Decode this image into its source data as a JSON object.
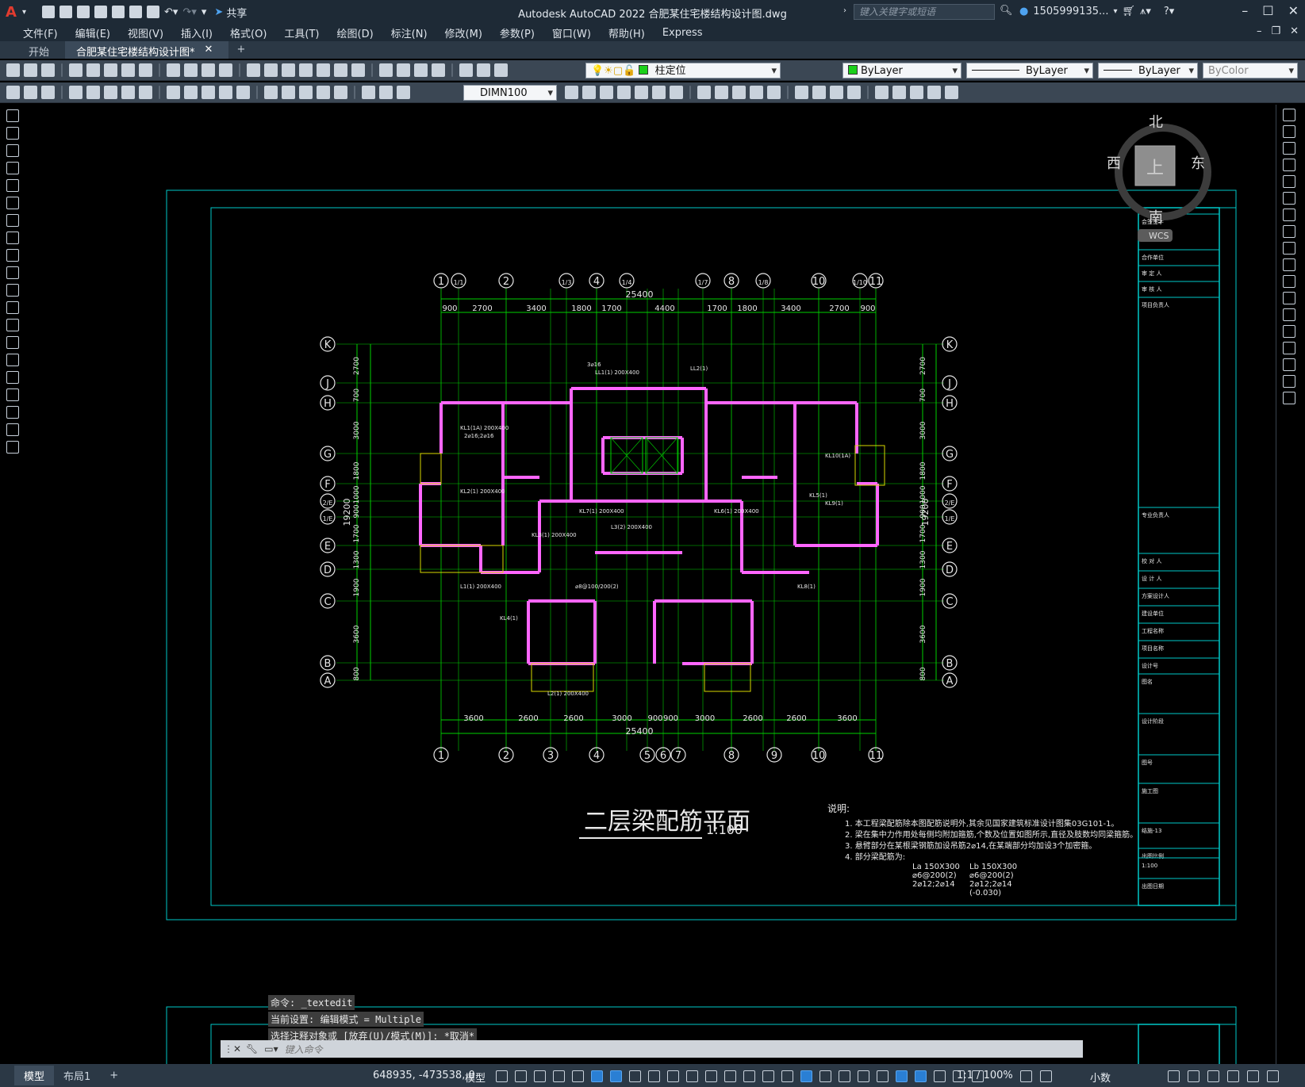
{
  "app": {
    "logo": "A",
    "title": "Autodesk AutoCAD 2022    合肥某住宅楼结构设计图.dwg",
    "share_label": "共享",
    "search_placeholder": "键入关键字或短语",
    "user": "1505999135...",
    "accent": "#e13b2f"
  },
  "menu": [
    "文件(F)",
    "编辑(E)",
    "视图(V)",
    "插入(I)",
    "格式(O)",
    "工具(T)",
    "绘图(D)",
    "标注(N)",
    "修改(M)",
    "参数(P)",
    "窗口(W)",
    "帮助(H)",
    "Express"
  ],
  "tabs": {
    "start": "开始",
    "doc": "合肥某住宅楼结构设计图*",
    "close": "✕",
    "add": "+"
  },
  "toolbar": {
    "layer": "柱定位",
    "color": "ByLayer",
    "linetype": "ByLayer",
    "lineweight": "ByLayer",
    "plotstyle": "ByColor",
    "dimstyle": "DIMN100"
  },
  "viewcube": {
    "north": "北",
    "south": "南",
    "east": "东",
    "west": "西",
    "top": "上",
    "wcs": "WCS"
  },
  "drawing": {
    "title": "二层梁配筋平面",
    "scale": "1:100",
    "top_total": "25400",
    "bottom_total": "25400",
    "left_total": "19200",
    "right_total": "19200",
    "top_dims": [
      "900",
      "2700",
      "3400",
      "1800",
      "1700",
      "4400",
      "1700",
      "1800",
      "3400",
      "2700",
      "900"
    ],
    "bottom_dims": [
      "3600",
      "2600",
      "2600",
      "3000",
      "900",
      "900",
      "3000",
      "2600",
      "2600",
      "3600"
    ],
    "left_dims": [
      "2700",
      "700",
      "3000",
      "1800",
      "1000",
      "900",
      "1700",
      "1300",
      "1900",
      "3600",
      "800"
    ],
    "top_axes": [
      "1",
      "1/1",
      "2",
      "1/3",
      "4",
      "1/4",
      "1/7",
      "8",
      "1/8",
      "10",
      "1/10",
      "11"
    ],
    "bottom_axes": [
      "1",
      "2",
      "3",
      "4",
      "5",
      "6",
      "7",
      "8",
      "9",
      "10",
      "11"
    ],
    "left_axes": [
      "K",
      "J",
      "H",
      "G",
      "F",
      "2/E",
      "1/E",
      "E",
      "D",
      "C",
      "B",
      "A"
    ],
    "notes_title": "说明:",
    "notes": [
      "1. 本工程梁配筋除本图配筋说明外,其余见国家建筑标准设计图集03G101-1。",
      "2. 梁在集中力作用处每侧均附加箍筋,个数及位置如图所示,直径及肢数均同梁箍筋。",
      "3. 悬臂部分在某根梁钢筋加设吊筋2⌀14,在某端部分均加设3个加密箍。",
      "4. 部分梁配筋为:"
    ],
    "beam_la": [
      "La 150X300",
      "⌀6@200(2)",
      "2⌀12;2⌀14"
    ],
    "beam_lb": [
      "Lb 150X300",
      "⌀6@200(2)",
      "2⌀12;2⌀14",
      "(-0.030)"
    ],
    "beam_labels": [
      "KL1(1A) 200X400",
      "KL2(1) 200X400",
      "KL3(1) 200X400",
      "KL4(1)",
      "KL5(1)",
      "KL6(1) 200X400",
      "KL7(1) 200X400",
      "KL8(1)",
      "KL9(1)",
      "KL10(1A)",
      "L1(1) 200X400",
      "L2(1) 200X400",
      "LL1(1) 200X400",
      "LL2(1)",
      "L3(2) 200X400",
      "3⌀16",
      "2⌀16;2⌀16",
      "⌀8@100/200(2)"
    ],
    "title_block": [
      "会签签字",
      "合作单位",
      "审 定 人",
      "审 核 人",
      "项目负责人",
      "专业负责人",
      "校 对 人",
      "设 计 人",
      "方案设计人",
      "建设单位",
      "工程名称",
      "项目名称",
      "设计号",
      "图名",
      "设计阶段",
      "图号",
      "施工图",
      "结施-13",
      "出图比例",
      "1:100",
      "出图日期"
    ]
  },
  "command": {
    "history": [
      "命令: _textedit",
      "当前设置: 编辑模式 = Multiple",
      "选择注释对象或 [放弃(U)/模式(M)]: *取消*"
    ],
    "prompt": "键入命令"
  },
  "status": {
    "model_tab": "模型",
    "layout_tab": "布局1",
    "add": "+",
    "coords": "648935, -473538, 0",
    "space": "模型",
    "scale": "1:1 / 100%",
    "units": "小数"
  }
}
